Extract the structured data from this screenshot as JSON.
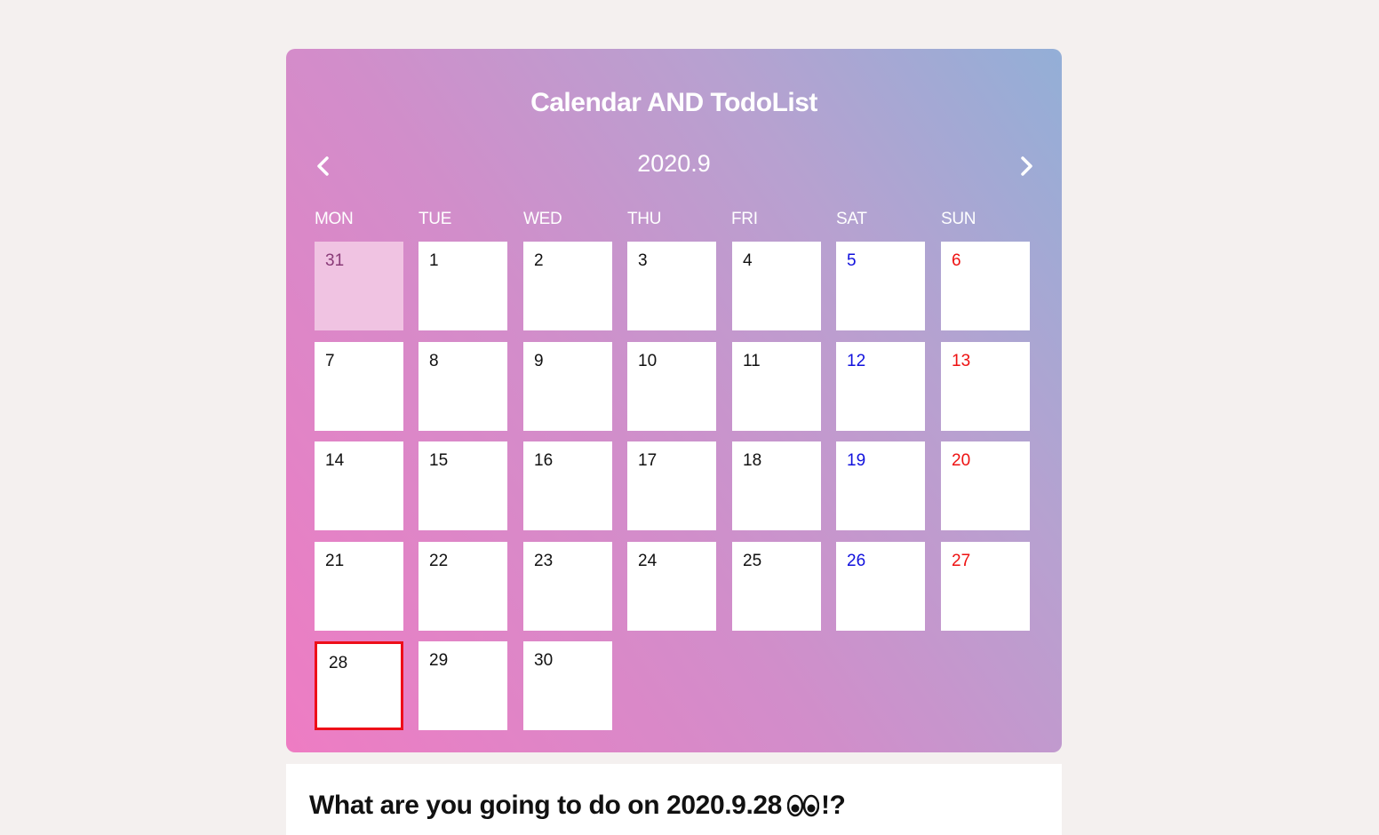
{
  "app": {
    "title": "Calendar AND TodoList"
  },
  "calendar": {
    "month_label": "2020.9",
    "prev_icon": "chevron-left-icon",
    "next_icon": "chevron-right-icon",
    "weekdays": [
      "MON",
      "TUE",
      "WED",
      "THU",
      "FRI",
      "SAT",
      "SUN"
    ],
    "days": [
      {
        "label": "31",
        "type": "other-month"
      },
      {
        "label": "1",
        "type": "weekday"
      },
      {
        "label": "2",
        "type": "weekday"
      },
      {
        "label": "3",
        "type": "weekday"
      },
      {
        "label": "4",
        "type": "weekday"
      },
      {
        "label": "5",
        "type": "sat"
      },
      {
        "label": "6",
        "type": "sun"
      },
      {
        "label": "7",
        "type": "weekday"
      },
      {
        "label": "8",
        "type": "weekday"
      },
      {
        "label": "9",
        "type": "weekday"
      },
      {
        "label": "10",
        "type": "weekday"
      },
      {
        "label": "11",
        "type": "weekday"
      },
      {
        "label": "12",
        "type": "sat"
      },
      {
        "label": "13",
        "type": "sun"
      },
      {
        "label": "14",
        "type": "weekday"
      },
      {
        "label": "15",
        "type": "weekday"
      },
      {
        "label": "16",
        "type": "weekday"
      },
      {
        "label": "17",
        "type": "weekday"
      },
      {
        "label": "18",
        "type": "weekday"
      },
      {
        "label": "19",
        "type": "sat"
      },
      {
        "label": "20",
        "type": "sun"
      },
      {
        "label": "21",
        "type": "weekday"
      },
      {
        "label": "22",
        "type": "weekday"
      },
      {
        "label": "23",
        "type": "weekday"
      },
      {
        "label": "24",
        "type": "weekday"
      },
      {
        "label": "25",
        "type": "weekday"
      },
      {
        "label": "26",
        "type": "sat"
      },
      {
        "label": "27",
        "type": "sun"
      },
      {
        "label": "28",
        "type": "weekday",
        "selected": true
      },
      {
        "label": "29",
        "type": "weekday"
      },
      {
        "label": "30",
        "type": "weekday"
      }
    ],
    "colors": {
      "saturday": "#1111dd",
      "sunday": "#ee1111",
      "selected_border": "#ee0e19",
      "other_month_bg": "#f0c3e2"
    }
  },
  "todo": {
    "heading_prefix": "What are you going to do on 2020.9.28",
    "heading_icon": "eyes-icon",
    "heading_suffix": "!?"
  }
}
